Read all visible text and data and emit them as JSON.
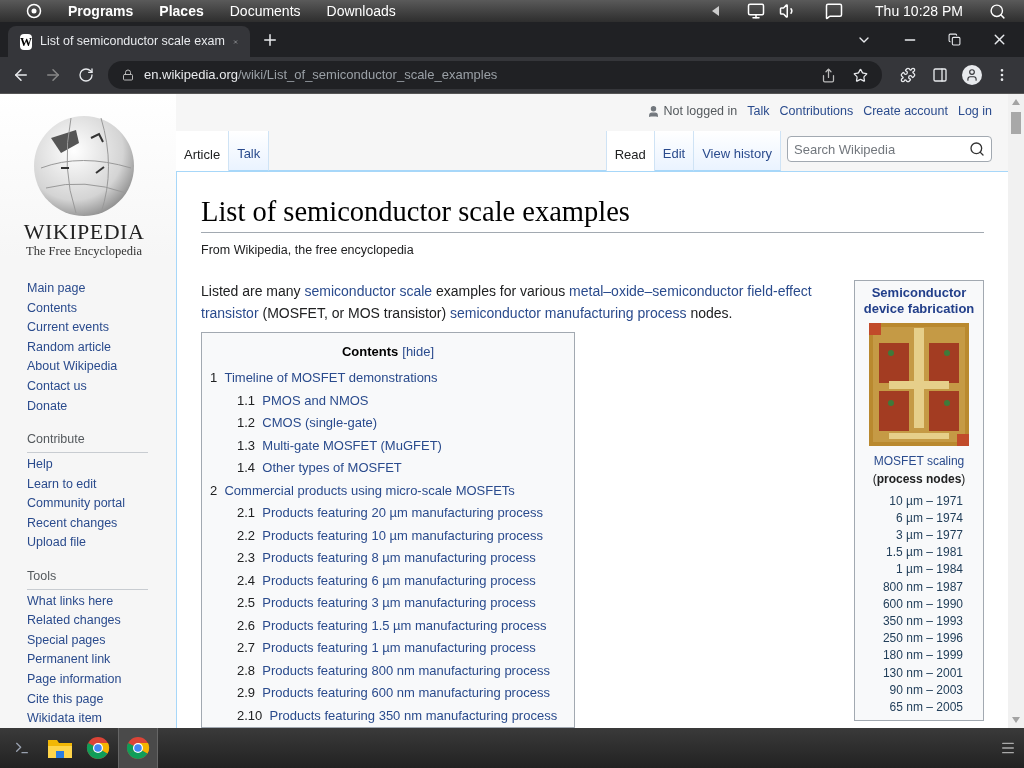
{
  "system_bar": {
    "menus": [
      {
        "label": "Programs",
        "bold": true
      },
      {
        "label": "Places",
        "bold": true
      },
      {
        "label": "Documents",
        "bold": false
      },
      {
        "label": "Downloads",
        "bold": false
      }
    ],
    "clock": "Thu 10:28 PM"
  },
  "browser": {
    "tab": {
      "title": "List of semiconductor scale exam",
      "favicon": "W"
    },
    "url": {
      "host": "en.wikipedia.org",
      "path": "/wiki/List_of_semiconductor_scale_examples"
    }
  },
  "sidebar": {
    "logo": {
      "wordmark": "WIKIPEDIA",
      "tagline": "The Free Encyclopedia"
    },
    "sections": [
      {
        "items": [
          "Main page",
          "Contents",
          "Current events",
          "Random article",
          "About Wikipedia",
          "Contact us",
          "Donate"
        ]
      },
      {
        "heading": "Contribute",
        "items": [
          "Help",
          "Learn to edit",
          "Community portal",
          "Recent changes",
          "Upload file"
        ]
      },
      {
        "heading": "Tools",
        "items": [
          "What links here",
          "Related changes",
          "Special pages",
          "Permanent link",
          "Page information",
          "Cite this page",
          "Wikidata item"
        ]
      }
    ]
  },
  "user_links": [
    {
      "label": "Not logged in",
      "kind": "status"
    },
    {
      "label": "Talk",
      "kind": "link"
    },
    {
      "label": "Contributions",
      "kind": "link"
    },
    {
      "label": "Create account",
      "kind": "link"
    },
    {
      "label": "Log in",
      "kind": "link"
    }
  ],
  "namespace_tabs": [
    {
      "label": "Article",
      "selected": true
    },
    {
      "label": "Talk",
      "selected": false
    }
  ],
  "view_tabs": [
    {
      "label": "Read",
      "selected": true
    },
    {
      "label": "Edit",
      "selected": false
    },
    {
      "label": "View history",
      "selected": false
    }
  ],
  "search": {
    "placeholder": "Search Wikipedia"
  },
  "article": {
    "title": "List of semiconductor scale examples",
    "tagline": "From Wikipedia, the free encyclopedia",
    "intro": [
      {
        "kind": "text",
        "text": "Listed are many"
      },
      {
        "kind": "link",
        "text": "semiconductor scale"
      },
      {
        "kind": "text",
        "text": "examples for various"
      },
      {
        "kind": "link",
        "text": "metal–oxide–semiconductor field-effect"
      },
      {
        "kind": "link",
        "text": "transistor"
      },
      {
        "kind": "text",
        "text": "(MOSFET, or MOS transistor)"
      },
      {
        "kind": "link",
        "text": "semiconductor manufacturing process"
      },
      {
        "kind": "text",
        "text": "nodes."
      }
    ],
    "toc": {
      "title": "Contents",
      "toggle": "[hide]",
      "entries": [
        {
          "number": "1",
          "label": "Timeline of MOSFET demonstrations",
          "children": [
            {
              "number": "1.1",
              "label": "PMOS and NMOS"
            },
            {
              "number": "1.2",
              "label": "CMOS (single-gate)"
            },
            {
              "number": "1.3",
              "label": "Multi-gate MOSFET (MuGFET)"
            },
            {
              "number": "1.4",
              "label": "Other types of MOSFET"
            }
          ]
        },
        {
          "number": "2",
          "label": "Commercial products using micro-scale MOSFETs",
          "children": [
            {
              "number": "2.1",
              "label": "Products featuring 20 µm manufacturing process"
            },
            {
              "number": "2.2",
              "label": "Products featuring 10 µm manufacturing process"
            },
            {
              "number": "2.3",
              "label": "Products featuring 8 µm manufacturing process"
            },
            {
              "number": "2.4",
              "label": "Products featuring 6 µm manufacturing process"
            },
            {
              "number": "2.5",
              "label": "Products featuring 3 µm manufacturing process"
            },
            {
              "number": "2.6",
              "label": "Products featuring 1.5 µm manufacturing process"
            },
            {
              "number": "2.7",
              "label": "Products featuring 1 µm manufacturing process"
            },
            {
              "number": "2.8",
              "label": "Products featuring 800 nm manufacturing process"
            },
            {
              "number": "2.9",
              "label": "Products featuring 600 nm manufacturing process"
            },
            {
              "number": "2.10",
              "label": "Products featuring 350 nm manufacturing process"
            }
          ]
        }
      ]
    }
  },
  "infobox": {
    "title": "Semiconductor device fabrication",
    "link": "MOSFET scaling",
    "subtitle": "(**process nodes**)",
    "nodes": [
      "10 µm – 1971",
      "6 µm – 1974",
      "3 µm – 1977",
      "1.5 µm – 1981",
      "1 µm – 1984",
      "800 nm – 1987",
      "600 nm – 1990",
      "350 nm – 1993",
      "250 nm – 1996",
      "180 nm – 1999",
      "130 nm – 2001",
      "90 nm – 2003",
      "65 nm – 2005"
    ]
  },
  "taskbar": {
    "apps": [
      {
        "kind": "terminal",
        "selected": false
      },
      {
        "kind": "folder",
        "selected": false
      },
      {
        "kind": "chrome",
        "selected": false
      },
      {
        "kind": "chrome",
        "selected": true
      }
    ]
  }
}
